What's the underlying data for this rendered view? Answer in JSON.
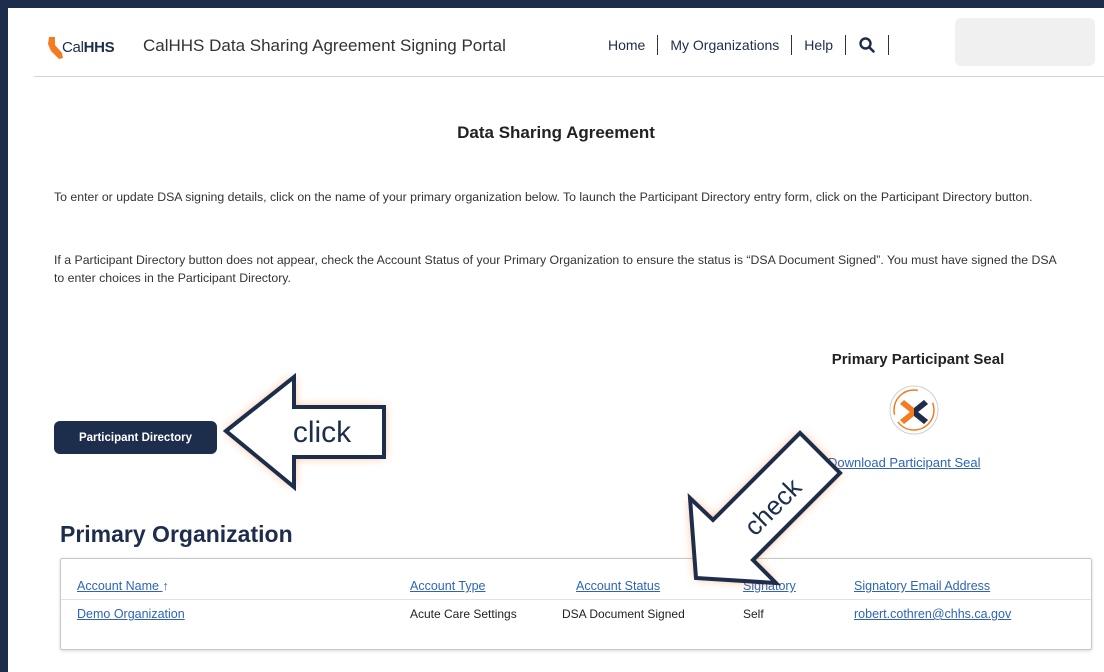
{
  "header": {
    "logo": {
      "cal": "Cal",
      "hhs": "HHS"
    },
    "portal_title": "CalHHS Data Sharing Agreement Signing Portal",
    "nav": {
      "home": "Home",
      "my_organizations": "My Organizations",
      "help": "Help",
      "search_icon": "search-icon"
    }
  },
  "main": {
    "title": "Data Sharing Agreement",
    "intro1": "To enter or update DSA signing details, click on the name of your primary organization below. To launch the Participant Directory entry form, click on the Participant Directory button.",
    "intro2": "If a Participant Directory button does not appear, check the Account Status of your Primary Organization to ensure the status is “DSA Document Signed”. You must have signed the DSA to enter choices in the Participant Directory.",
    "participant_directory_button": "Participant Directory",
    "seal": {
      "title": "Primary Participant Seal",
      "download_link": "Download Participant Seal"
    }
  },
  "primary_organization": {
    "heading": "Primary Organization",
    "columns": [
      "Account Name",
      "Account Type",
      "Account Status",
      "Signatory",
      "Signatory Email Address"
    ],
    "sort_indicator": "↑",
    "rows": [
      {
        "account_name": "Demo Organization",
        "account_type": "Acute Care Settings",
        "account_status": "DSA Document Signed",
        "signatory": "Self",
        "email": "robert.cothren@chhs.ca.gov"
      }
    ]
  },
  "annotations": {
    "click_label": "click",
    "check_label": "check",
    "arrow_fill": "#ffffff",
    "arrow_stroke": "#1d2d4c",
    "glow": "#f7934c"
  },
  "colors": {
    "brand_navy": "#1d2d4c",
    "link_blue": "#2e64b8",
    "logo_orange": "#f47b20"
  }
}
